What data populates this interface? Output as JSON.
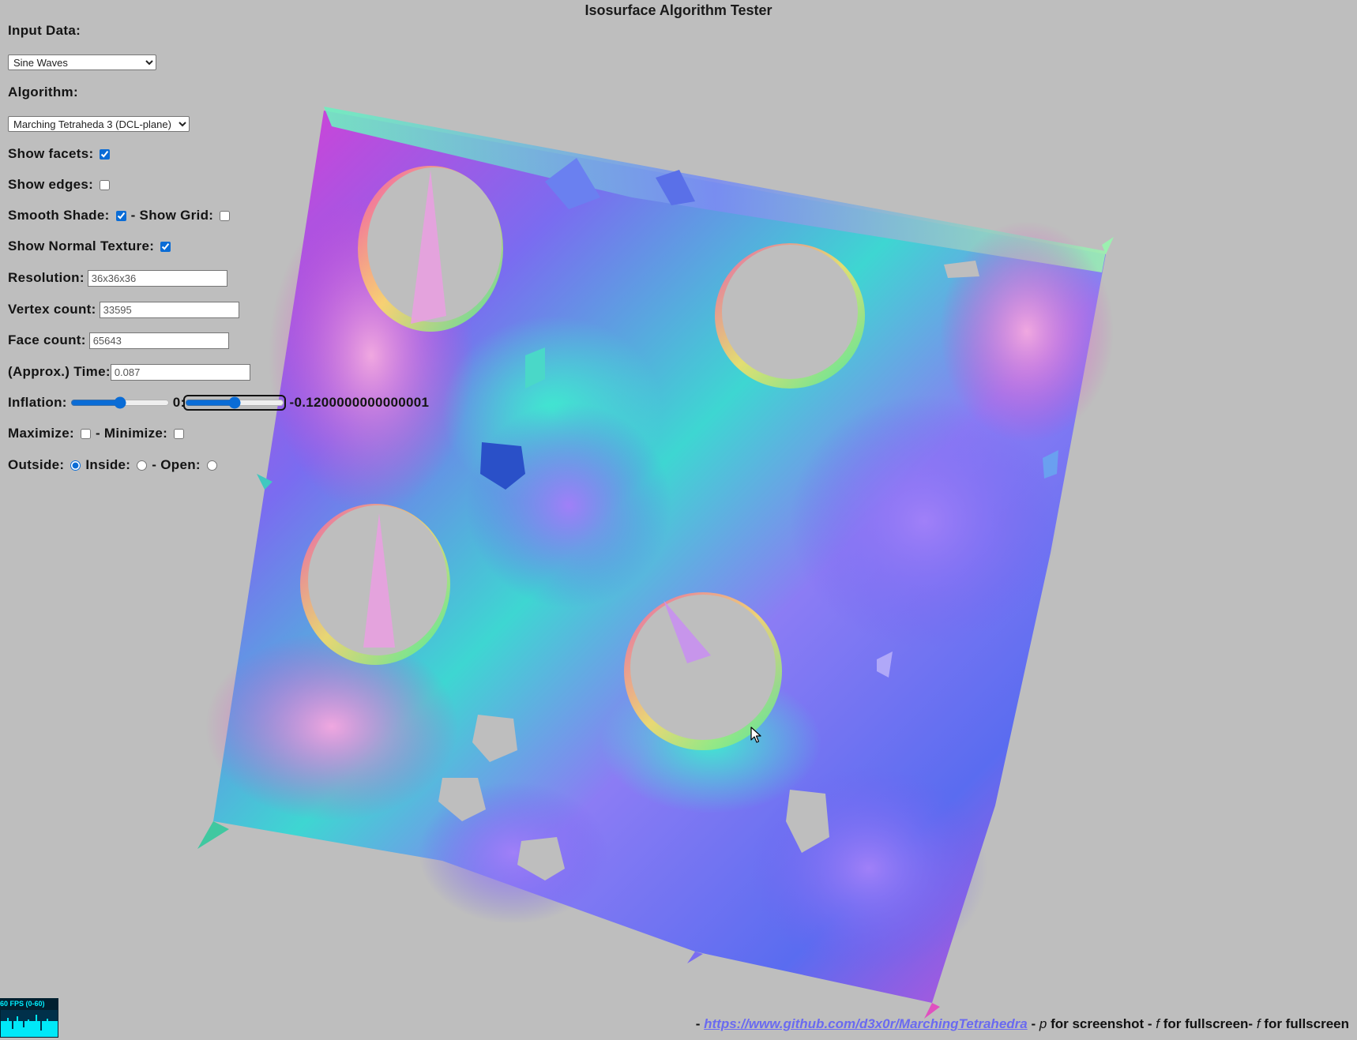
{
  "app": {
    "title": "Isosurface Algorithm Tester"
  },
  "controls": {
    "input_data_label": "Input Data:",
    "input_data_selected": "Sine Waves",
    "algorithm_label": "Algorithm:",
    "algorithm_selected": "Marching Tetraheda 3 (DCL-plane)",
    "show_facets_label": "Show facets:",
    "show_facets_checked": true,
    "show_edges_label": "Show edges:",
    "show_edges_checked": false,
    "smooth_shade_label": "Smooth Shade:",
    "smooth_shade_checked": true,
    "show_grid_label": "- Show Grid:",
    "show_grid_checked": false,
    "show_normal_texture_label": "Show Normal Texture:",
    "show_normal_texture_checked": true,
    "resolution_label": "Resolution:",
    "resolution_value": "36x36x36",
    "vertex_count_label": "Vertex count:",
    "vertex_count_value": "33595",
    "face_count_label": "Face count:",
    "face_count_value": "65643",
    "time_label": "(Approx.) Time:",
    "time_value": "0.087",
    "inflation_label": "Inflation:",
    "inflation_fraction": 0.5,
    "inflation_zero_label": "0:",
    "inflation_fine_fraction": 0.5,
    "inflation_value_text": "-0.1200000000000001",
    "maximize_label": "Maximize:",
    "maximize_checked": false,
    "minimize_label": "- Minimize:",
    "minimize_checked": false,
    "outside_label": "Outside:",
    "inside_label": "Inside:",
    "open_label": "- Open:",
    "surface_mode_selected": "outside"
  },
  "stats": {
    "fps_text": "60 FPS (0-60)"
  },
  "footer": {
    "prefix": "- ",
    "link_text": "https://www.github.com/d3x0r/MarchingTetrahedra",
    "sep1": " - ",
    "key_p": "p",
    "screenshot_text": " for screenshot - ",
    "key_f1": "f",
    "fullscreen_text1": " for fullscreen- ",
    "key_f2": "f",
    "fullscreen_text2": " for fullscreen"
  },
  "icons": {
    "cursor": "mouse-pointer-icon"
  },
  "colors": {
    "background": "#bebebe",
    "accent": "#0a6cd6",
    "link": "#6a6af0",
    "fps_text": "#00f0ff"
  }
}
